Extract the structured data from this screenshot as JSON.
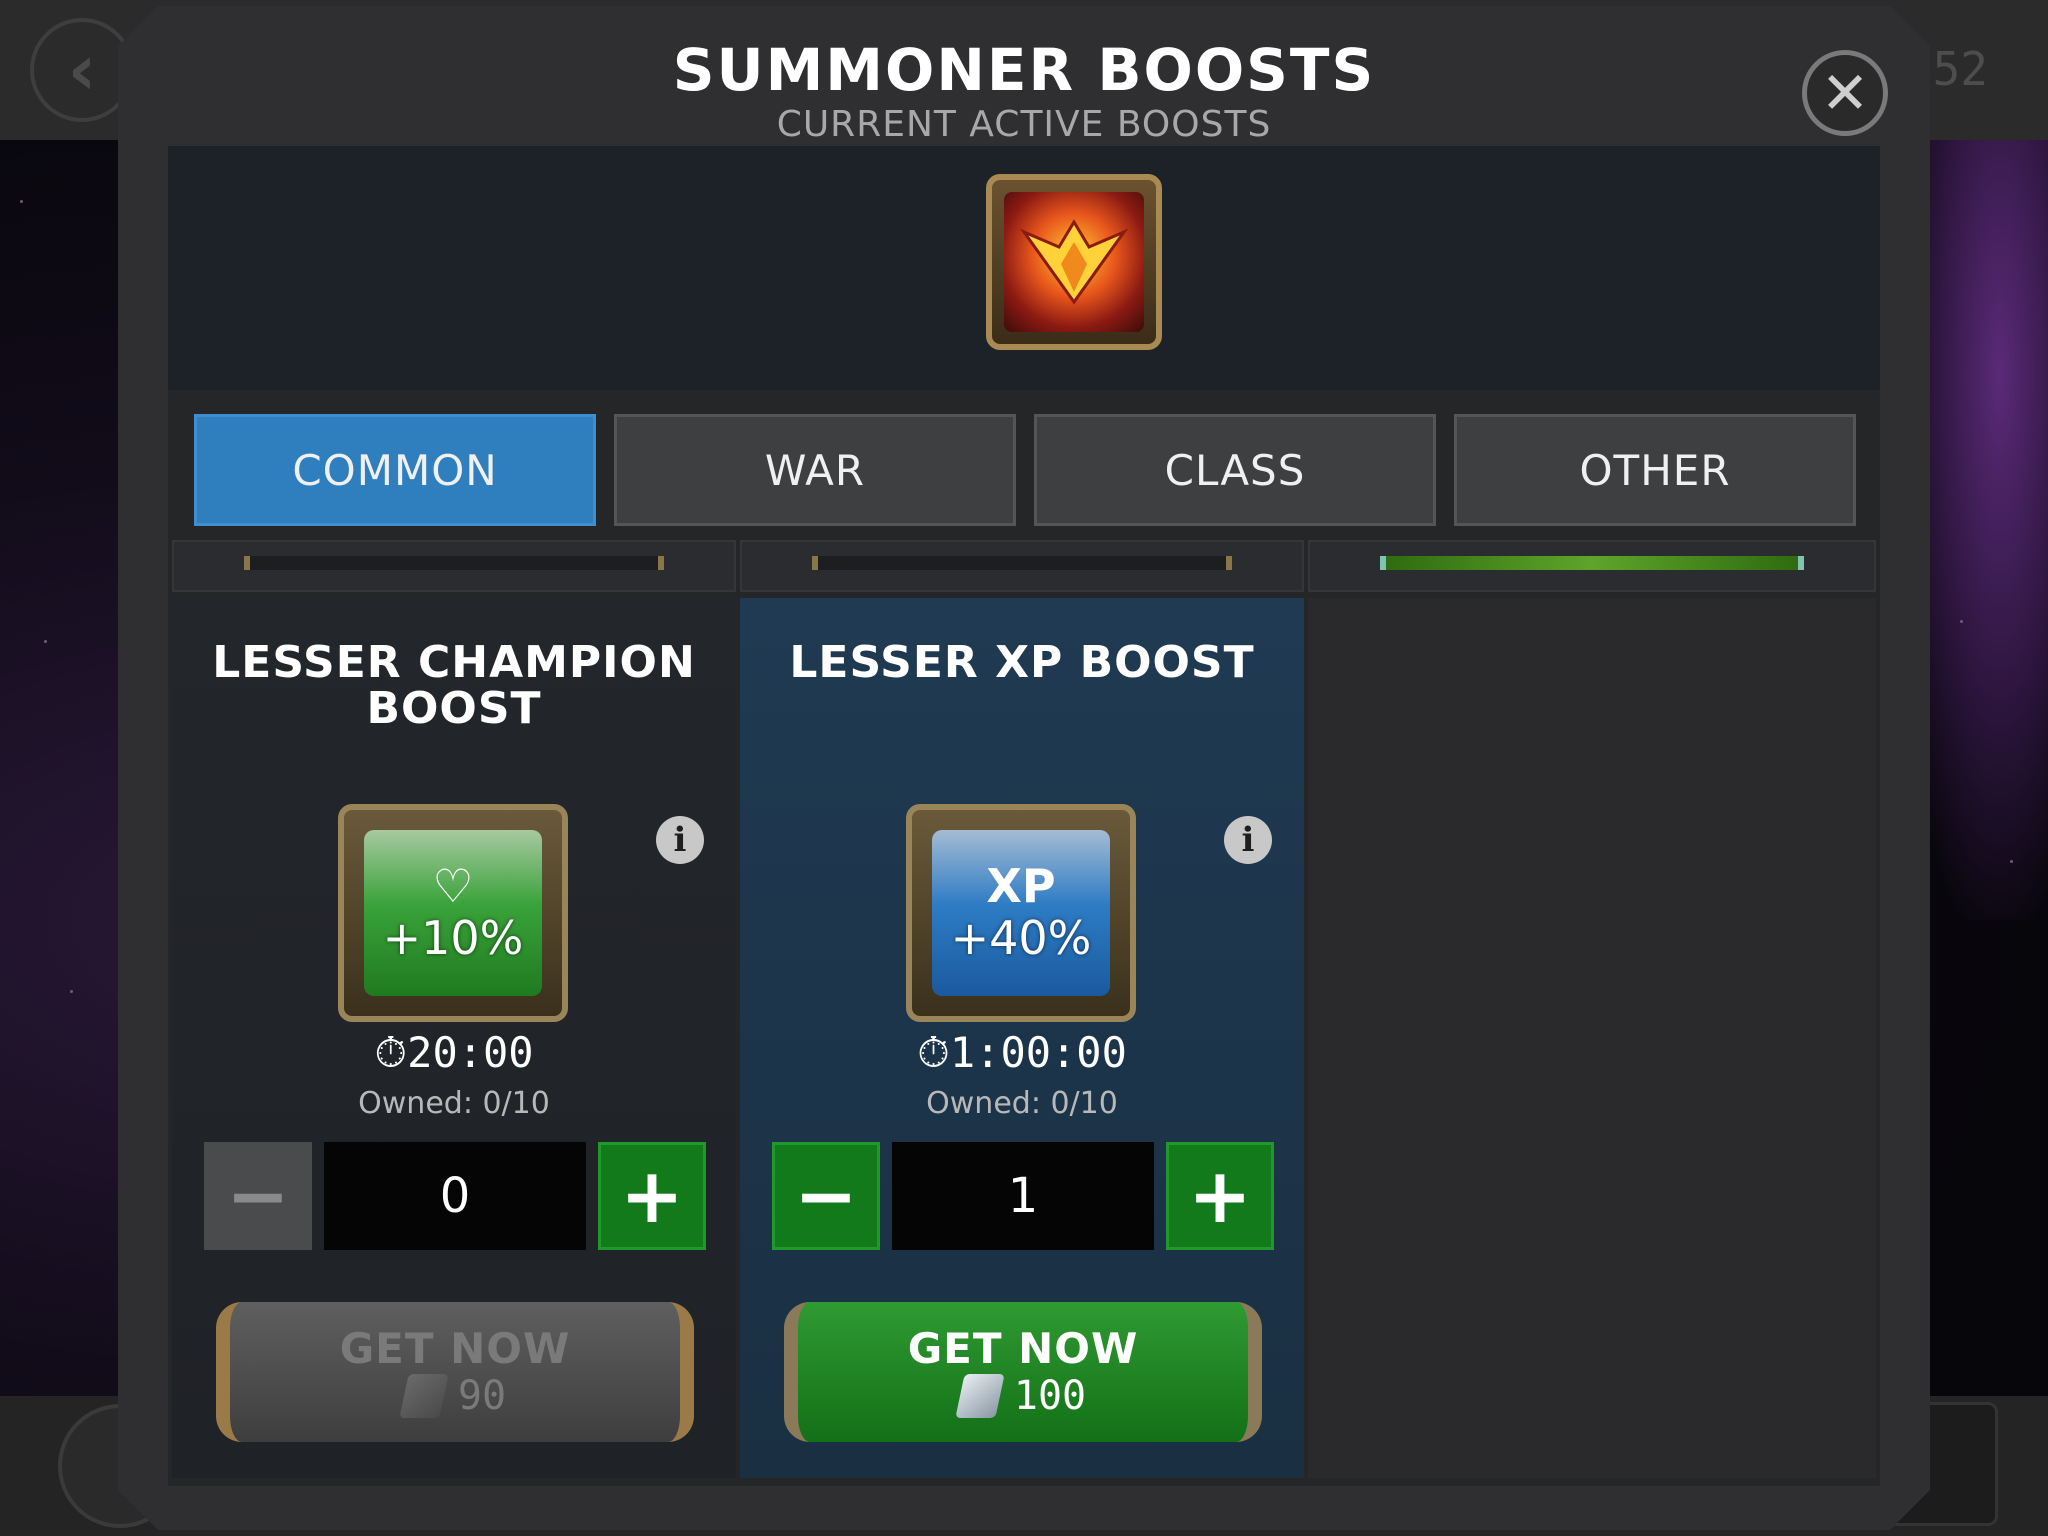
{
  "modal": {
    "title": "SUMMONER BOOSTS",
    "subtitle": "CURRENT ACTIVE BOOSTS",
    "close_icon": "close-icon"
  },
  "background": {
    "counter": "52",
    "back_icon": "back-arrow-icon"
  },
  "active_boosts": [
    {
      "icon": "phoenix-emblem-icon"
    }
  ],
  "tabs": [
    {
      "label": "COMMON",
      "active": true
    },
    {
      "label": "WAR",
      "active": false
    },
    {
      "label": "CLASS",
      "active": false
    },
    {
      "label": "OTHER",
      "active": false
    }
  ],
  "boosts": [
    {
      "title": "LESSER CHAMPION BOOST",
      "symbol": "♡",
      "percent": "+10%",
      "timer": "20:00",
      "owned": "Owned: 0/10",
      "quantity": "0",
      "minus_enabled": false,
      "get_now_label": "GET NOW",
      "price": "90",
      "get_now_enabled": false,
      "tile_color": "#2f9a32"
    },
    {
      "title": "LESSER XP BOOST",
      "symbol": "XP",
      "percent": "+40%",
      "timer": "1:00:00",
      "owned": "Owned: 0/10",
      "quantity": "1",
      "minus_enabled": true,
      "get_now_label": "GET NOW",
      "price": "100",
      "get_now_enabled": true,
      "tile_color": "#2e7cc5"
    }
  ],
  "colors": {
    "tab_active": "#2f7fbf",
    "step_green": "#137a1c",
    "button_green": "#2f9a32"
  }
}
